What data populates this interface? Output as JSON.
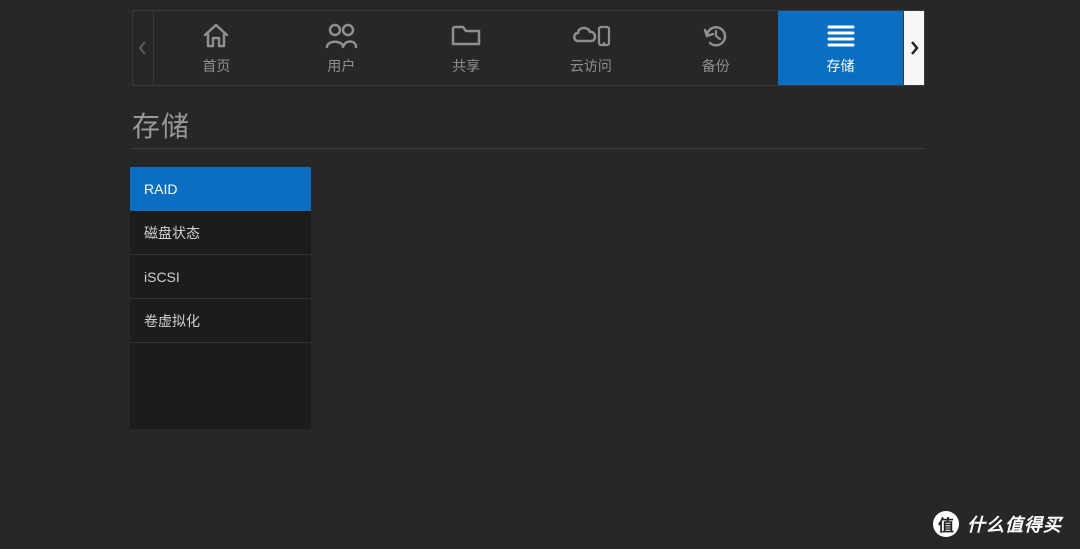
{
  "nav": {
    "items": [
      {
        "label": "首页",
        "icon": "home"
      },
      {
        "label": "用户",
        "icon": "users"
      },
      {
        "label": "共享",
        "icon": "folder"
      },
      {
        "label": "云访问",
        "icon": "cloud"
      },
      {
        "label": "备份",
        "icon": "backup"
      },
      {
        "label": "存储",
        "icon": "storage",
        "active": true
      }
    ]
  },
  "page": {
    "title": "存储"
  },
  "sidebar": {
    "items": [
      {
        "label": "RAID",
        "active": true
      },
      {
        "label": "磁盘状态"
      },
      {
        "label": "iSCSI"
      },
      {
        "label": "卷虚拟化"
      }
    ]
  },
  "watermark": {
    "badge": "值",
    "text": "什么值得买"
  }
}
